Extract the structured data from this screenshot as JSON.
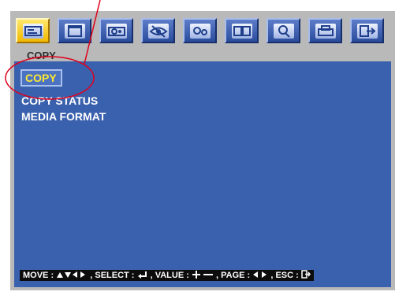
{
  "menu": {
    "section_title": "COPY",
    "tabs": [
      {
        "icon": "copy-icon",
        "active": true
      },
      {
        "icon": "window-icon",
        "active": false
      },
      {
        "icon": "camera-icon",
        "active": false
      },
      {
        "icon": "eye-icon",
        "active": false
      },
      {
        "icon": "settings-icon",
        "active": false
      },
      {
        "icon": "display-icon",
        "active": false
      },
      {
        "icon": "search-icon",
        "active": false
      },
      {
        "icon": "print-icon",
        "active": false
      },
      {
        "icon": "exit-icon",
        "active": false
      }
    ],
    "items": [
      {
        "label": "COPY",
        "selected": true
      },
      {
        "label": "COPY STATUS",
        "selected": false
      },
      {
        "label": "MEDIA FORMAT",
        "selected": false
      }
    ]
  },
  "help_bar": {
    "move_label": "MOVE :",
    "select_label": ", SELECT :",
    "value_label": ", VALUE :",
    "page_label": ", PAGE :",
    "esc_label": ", ESC :"
  },
  "colors": {
    "panel": "#3a61ad",
    "highlight_text": "#ffe733",
    "annotation": "#e0001b"
  }
}
